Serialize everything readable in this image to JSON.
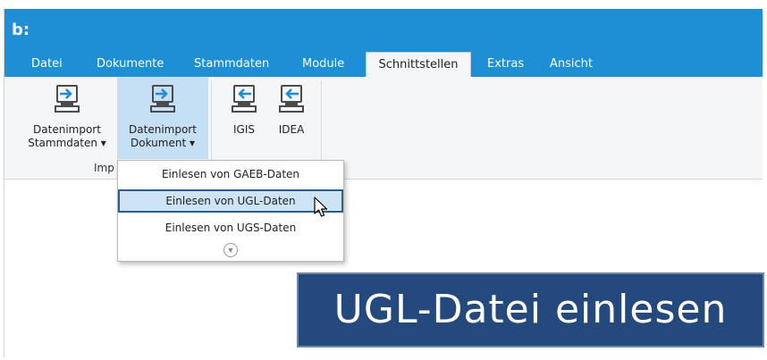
{
  "app": {
    "logo": "b:"
  },
  "menu": {
    "tabs": [
      {
        "label": "Datei"
      },
      {
        "label": "Dokumente"
      },
      {
        "label": "Stammdaten"
      },
      {
        "label": "Module"
      },
      {
        "label": "Schnittstellen",
        "active": true
      },
      {
        "label": "Extras"
      },
      {
        "label": "Ansicht"
      }
    ]
  },
  "ribbon": {
    "buttons": [
      {
        "line1": "Datenimport",
        "line2": "Stammdaten ▾",
        "icon": "computer-import-icon"
      },
      {
        "line1": "Datenimport",
        "line2": "Dokument ▾",
        "icon": "computer-import-icon"
      },
      {
        "line1": "IGIS",
        "line2": "",
        "icon": "computer-export-icon"
      },
      {
        "line1": "IDEA",
        "line2": "",
        "icon": "computer-export-icon"
      }
    ],
    "group_label": "Imp"
  },
  "dropdown": {
    "items": [
      {
        "label": "Einlesen von GAEB-Daten"
      },
      {
        "label": "Einlesen von UGL-Daten",
        "hover": true
      },
      {
        "label": "Einlesen von UGS-Daten"
      }
    ],
    "more_icon": "chevron-down-circle-icon"
  },
  "overlay": {
    "caption": "UGL-Datei einlesen"
  },
  "colors": {
    "titlebar": "#1e8fd4",
    "ribbon": "#f5f6f7",
    "pressed": "#c5dff4",
    "caption_bg": "#23497d",
    "icon_blue": "#1a8fd6"
  }
}
